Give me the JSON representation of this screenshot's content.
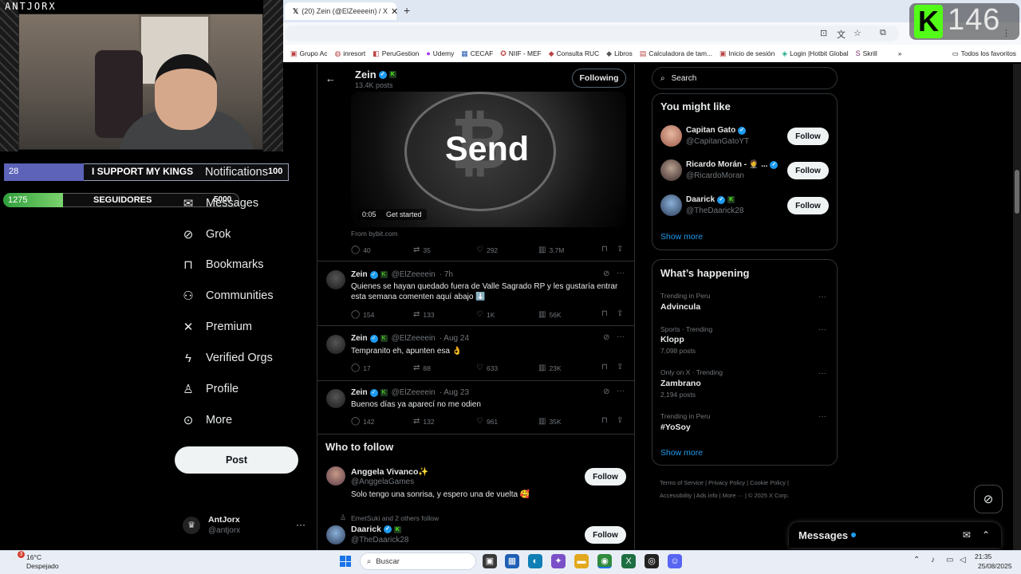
{
  "browser": {
    "tab_title": "(20) Zein (@ElZeeeein) / X",
    "tab_close": "✕",
    "new_tab": "+",
    "bookmarks": [
      "Grupo Ac",
      "inresort",
      "PeruGestion",
      "Udemy",
      "CECAF",
      "NIIF - MEF",
      "Consulta RUC",
      "Libros",
      "Calculadora de tam...",
      "Inicio de sesión",
      "Login |Hotbit Global",
      "Skrill"
    ],
    "bookmarks_overflow": "»",
    "all_bookmarks": "Todos los favoritos"
  },
  "overlay": {
    "label": "ANTJORX",
    "goal_value": "28",
    "goal_text": "I SUPPORT MY KINGS",
    "goal_max": "100",
    "goal_progress": 0.28,
    "followers_value": "1275",
    "followers_text": "SEGUIDORES",
    "followers_max": "5000",
    "followers_progress": 0.255,
    "kick_letter": "K",
    "kick_count": "146",
    "kick_color": "#53fc18"
  },
  "nav": {
    "notifications": "Notifications",
    "messages": "Messages",
    "grok": "Grok",
    "bookmarks": "Bookmarks",
    "communities": "Communities",
    "premium": "Premium",
    "verified_orgs": "Verified Orgs",
    "profile": "Profile",
    "more": "More",
    "post": "Post"
  },
  "account": {
    "name": "AntJorx",
    "handle": "@antjorx",
    "more": "···"
  },
  "profile_header": {
    "name": "Zein",
    "posts": "13.4K posts",
    "following": "Following"
  },
  "ad": {
    "media_text": "Send",
    "duration": "0:05",
    "cta": "Get started",
    "source": "From bybit.com",
    "replies": "40",
    "reposts": "35",
    "likes": "292",
    "views": "3.7M"
  },
  "tweets": [
    {
      "name": "Zein",
      "handle": "@ElZeeeein",
      "time": "· 7h",
      "text": "Quienes se hayan quedado fuera de Valle Sagrado RP y les gustaría entrar esta semana comenten aquí abajo ⬇️",
      "replies": "154",
      "reposts": "133",
      "likes": "1K",
      "views": "56K"
    },
    {
      "name": "Zein",
      "handle": "@ElZeeeein",
      "time": "· Aug 24",
      "text": "Tempranito eh, apunten esa 👌",
      "replies": "17",
      "reposts": "88",
      "likes": "633",
      "views": "23K"
    },
    {
      "name": "Zein",
      "handle": "@ElZeeeein",
      "time": "· Aug 23",
      "text": "Buenos días ya aparecí no me odien",
      "replies": "142",
      "reposts": "132",
      "likes": "961",
      "views": "35K"
    }
  ],
  "who_to_follow": {
    "title": "Who to follow",
    "users": [
      {
        "name": "Anggela Vivanco✨",
        "handle": "@AnggelaGames",
        "bio": "Solo tengo una sonrisa, y espero una de vuelta 🥰",
        "button": "Follow"
      },
      {
        "context": "EmetSuki and 2 others follow",
        "name": "Daarick",
        "handle": "@TheDaarick28",
        "button": "Follow"
      }
    ]
  },
  "search": {
    "placeholder": "Search"
  },
  "you_might_like": {
    "title": "You might like",
    "users": [
      {
        "name": "Capitan Gato",
        "handle": "@CapitanGatoYT",
        "button": "Follow"
      },
      {
        "name": "Ricardo Morán - 🤵 ...",
        "handle": "@RicardoMoran",
        "button": "Follow"
      },
      {
        "name": "Daarick",
        "handle": "@TheDaarick28",
        "button": "Follow"
      }
    ],
    "show_more": "Show more"
  },
  "whats_happening": {
    "title": "What’s happening",
    "trends": [
      {
        "category": "Trending in Peru",
        "name": "Advincula",
        "count": ""
      },
      {
        "category": "Sports · Trending",
        "name": "Klopp",
        "count": "7,098 posts"
      },
      {
        "category": "Only on X · Trending",
        "name": "Zambrano",
        "count": "2,194 posts"
      },
      {
        "category": "Trending in Peru",
        "name": "#YoSoy",
        "count": ""
      }
    ],
    "show_more": "Show more"
  },
  "footer": {
    "links": [
      "Terms of Service",
      "Privacy Policy",
      "Cookie Policy",
      "Accessibility",
      "Ads info",
      "More ···"
    ],
    "copyright": "© 2025 X Corp."
  },
  "messages_dock": {
    "title": "Messages"
  },
  "taskbar": {
    "weather_temp": "16°C",
    "weather_desc": "Despejado",
    "weather_badge": "3",
    "search": "Buscar",
    "time": "21:35",
    "date": "25/08/2025"
  },
  "colors": {
    "accent": "#1d9bf0",
    "background": "#000000",
    "border": "#2f3336",
    "muted": "#71767b"
  }
}
